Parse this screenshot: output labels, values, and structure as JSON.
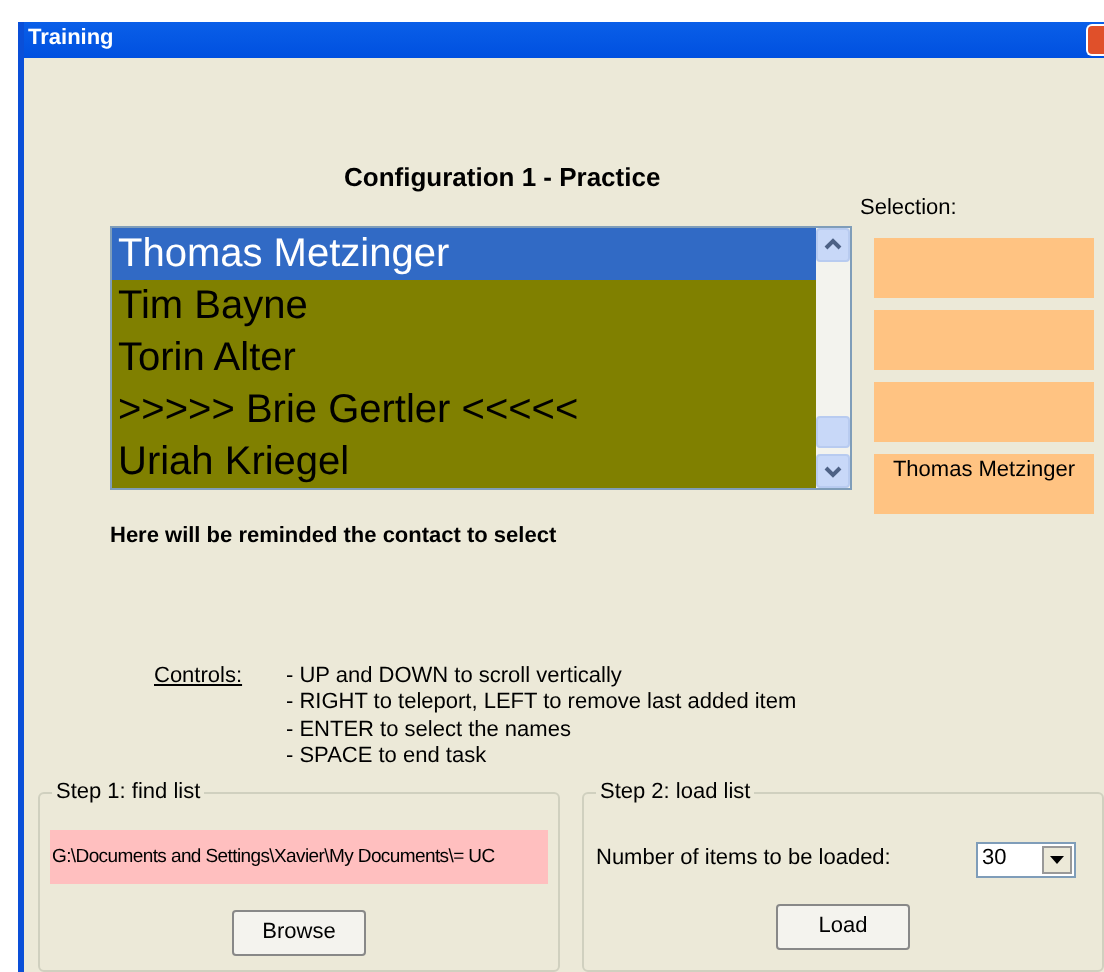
{
  "window": {
    "title": "Training"
  },
  "heading": "Configuration 1 - Practice",
  "list": {
    "items": [
      {
        "text": "Thomas Metzinger",
        "selected": true
      },
      {
        "text": "Tim Bayne",
        "selected": false
      },
      {
        "text": "Torin Alter",
        "selected": false
      },
      {
        "text": ">>>>> Brie Gertler <<<<<",
        "selected": false
      },
      {
        "text": "Uriah Kriegel",
        "selected": false
      }
    ]
  },
  "selection": {
    "label": "Selection:",
    "slots": [
      {
        "kind": "empty"
      },
      {
        "kind": "empty"
      },
      {
        "kind": "empty"
      },
      {
        "kind": "name",
        "text": "Thomas Metzinger"
      }
    ]
  },
  "reminder": "Here will be reminded the contact to select",
  "controls": {
    "label": "Controls:",
    "lines": [
      "- UP and DOWN to scroll vertically",
      "- RIGHT to teleport, LEFT to remove last added item",
      "- ENTER to select the names",
      "- SPACE to end task"
    ]
  },
  "step1": {
    "title": "Step 1: find list",
    "path": "G:\\Documents and Settings\\Xavier\\My Documents\\= UC",
    "button": "Browse"
  },
  "step2": {
    "title": "Step 2: load list",
    "label": "Number of items to be loaded:",
    "combo_value": "30",
    "button": "Load"
  }
}
